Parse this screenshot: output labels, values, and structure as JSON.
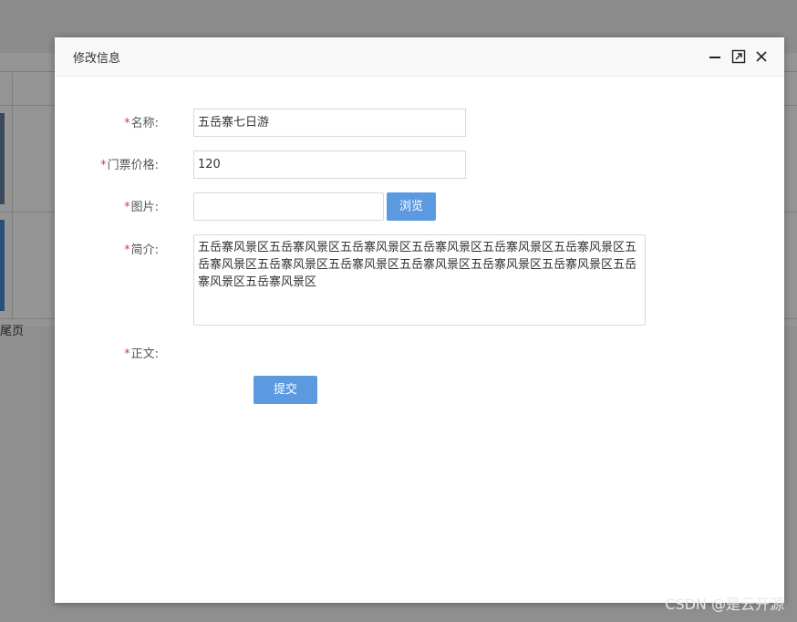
{
  "background": {
    "last_page_label": "尾页"
  },
  "modal": {
    "title": "修改信息",
    "header_icons": [
      "minimize-icon",
      "maximize-icon",
      "close-icon"
    ],
    "required_mark": "*",
    "fields": {
      "name": {
        "label": "名称:",
        "value": "五岳寨七日游"
      },
      "price": {
        "label": "门票价格:",
        "value": "120"
      },
      "image": {
        "label": "图片:",
        "value": "",
        "browse_label": "浏览"
      },
      "intro": {
        "label": "简介:",
        "value": "五岳寨风景区五岳寨风景区五岳寨风景区五岳寨风景区五岳寨风景区五岳寨风景区五岳寨风景区五岳寨风景区五岳寨风景区五岳寨风景区五岳寨风景区五岳寨风景区五岳寨风景区五岳寨风景区"
      },
      "body": {
        "label": "正文:"
      }
    },
    "submit_label": "提交"
  },
  "watermark": "CSDN @是云开源",
  "colors": {
    "accent": "#5b9ae0",
    "required": "#e4393c",
    "overlay_bg": "#8f8f8f"
  }
}
